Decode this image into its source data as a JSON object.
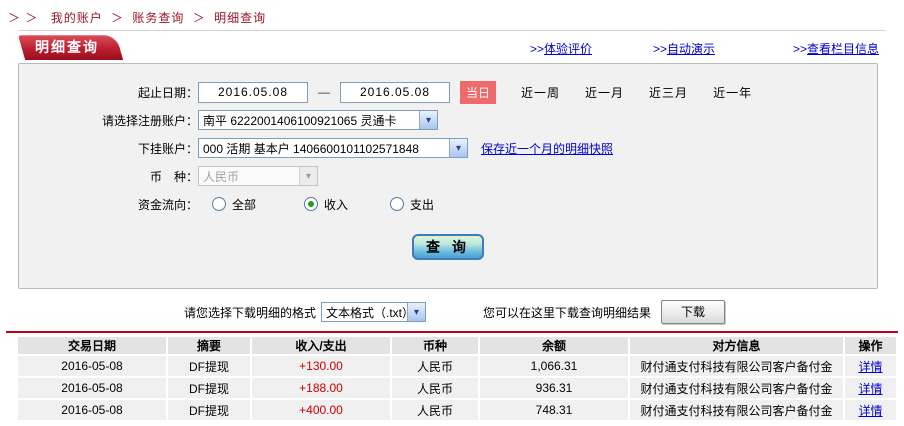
{
  "breadcrumb": {
    "arrows": "＞ ＞",
    "sep": "＞",
    "items": [
      "我的账户",
      "账务查询",
      "明细查询"
    ]
  },
  "tab": {
    "label": "明细查询"
  },
  "header_links": {
    "prefix": ">>",
    "items": [
      "体验评价",
      "自动演示",
      "查看栏目信息"
    ]
  },
  "icons": {
    "select_arrow": "▾"
  },
  "form": {
    "date_label": "起止日期：",
    "date_from": "2016.05.08",
    "date_to": "2016.05.08",
    "date_separator": "—",
    "quick_today": "当日",
    "quick_ranges": [
      "近一周",
      "近一月",
      "近三月",
      "近一年"
    ],
    "account_label": "请选择注册账户：",
    "account_value": "南平 6222001406100921065 灵通卡",
    "sub_account_label": "下挂账户：",
    "sub_account_value": "000 活期 基本户 1406600101102571848",
    "snapshot_link": "保存近一个月的明细快照",
    "currency_label": "币　种：",
    "currency_value": "人民币",
    "flow_label": "资金流向：",
    "flow_options": [
      {
        "label": "全部",
        "selected": false
      },
      {
        "label": "收入",
        "selected": true
      },
      {
        "label": "支出",
        "selected": false
      }
    ],
    "query_button": "查 询"
  },
  "download": {
    "format_label": "请您选择下载明细的格式",
    "format_value": "文本格式（.txt）",
    "hint": "您可以在这里下载查询明细结果",
    "button_label": "下载"
  },
  "table": {
    "columns": [
      "交易日期",
      "摘要",
      "收入/支出",
      "币种",
      "余额",
      "对方信息",
      "操作"
    ],
    "rows": [
      {
        "date": "2016-05-08",
        "summary": "DF提现",
        "amount": "+130.00",
        "currency": "人民币",
        "balance": "1,066.31",
        "counterparty": "财付通支付科技有限公司客户备付金",
        "action": "详情"
      },
      {
        "date": "2016-05-08",
        "summary": "DF提现",
        "amount": "+188.00",
        "currency": "人民币",
        "balance": "936.31",
        "counterparty": "财付通支付科技有限公司客户备付金",
        "action": "详情"
      },
      {
        "date": "2016-05-08",
        "summary": "DF提现",
        "amount": "+400.00",
        "currency": "人民币",
        "balance": "748.31",
        "counterparty": "财付通支付科技有限公司客户备付金",
        "action": "详情"
      }
    ]
  },
  "colors": {
    "brand_red": "#9c101f",
    "badge_red": "#ef6a6a",
    "amount_red": "#cc0000",
    "link_blue": "#0000cc",
    "divider_red": "#c1001a"
  }
}
